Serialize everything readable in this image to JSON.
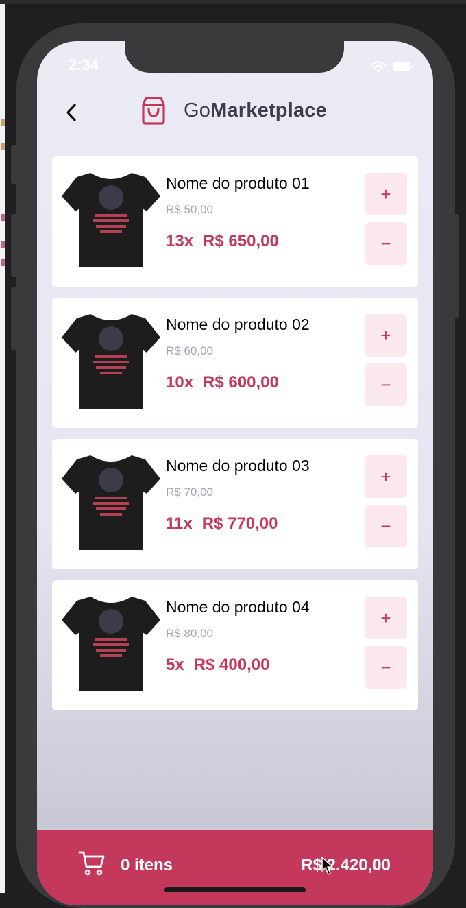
{
  "status_bar": {
    "time": "2:34"
  },
  "header": {
    "brand_light": "Go",
    "brand_bold": "Marketplace"
  },
  "products": [
    {
      "name": "Nome do produto 01",
      "unit_price": "R$ 50,00",
      "quantity": "13x",
      "subtotal": "R$ 650,00"
    },
    {
      "name": "Nome do produto 02",
      "unit_price": "R$ 60,00",
      "quantity": "10x",
      "subtotal": "R$ 600,00"
    },
    {
      "name": "Nome do produto 03",
      "unit_price": "R$ 70,00",
      "quantity": "11x",
      "subtotal": "R$ 770,00"
    },
    {
      "name": "Nome do produto 04",
      "unit_price": "R$ 80,00",
      "quantity": "5x",
      "subtotal": "R$ 400,00"
    }
  ],
  "buttons": {
    "increment": "+",
    "decrement": "−"
  },
  "footer": {
    "items_label": "0 itens",
    "total": "R$ 2.420,00"
  },
  "colors": {
    "accent": "#c4395b",
    "button_bg": "#fbe9ed",
    "card_bg": "#ffffff",
    "screen_bg": "#ebebf5",
    "text_muted": "#a4a4b0"
  },
  "icons": {
    "back": "chevron-left-icon",
    "logo": "shopping-bag-icon",
    "cart": "shopping-cart-icon",
    "product_image": "t-shirt-image"
  }
}
